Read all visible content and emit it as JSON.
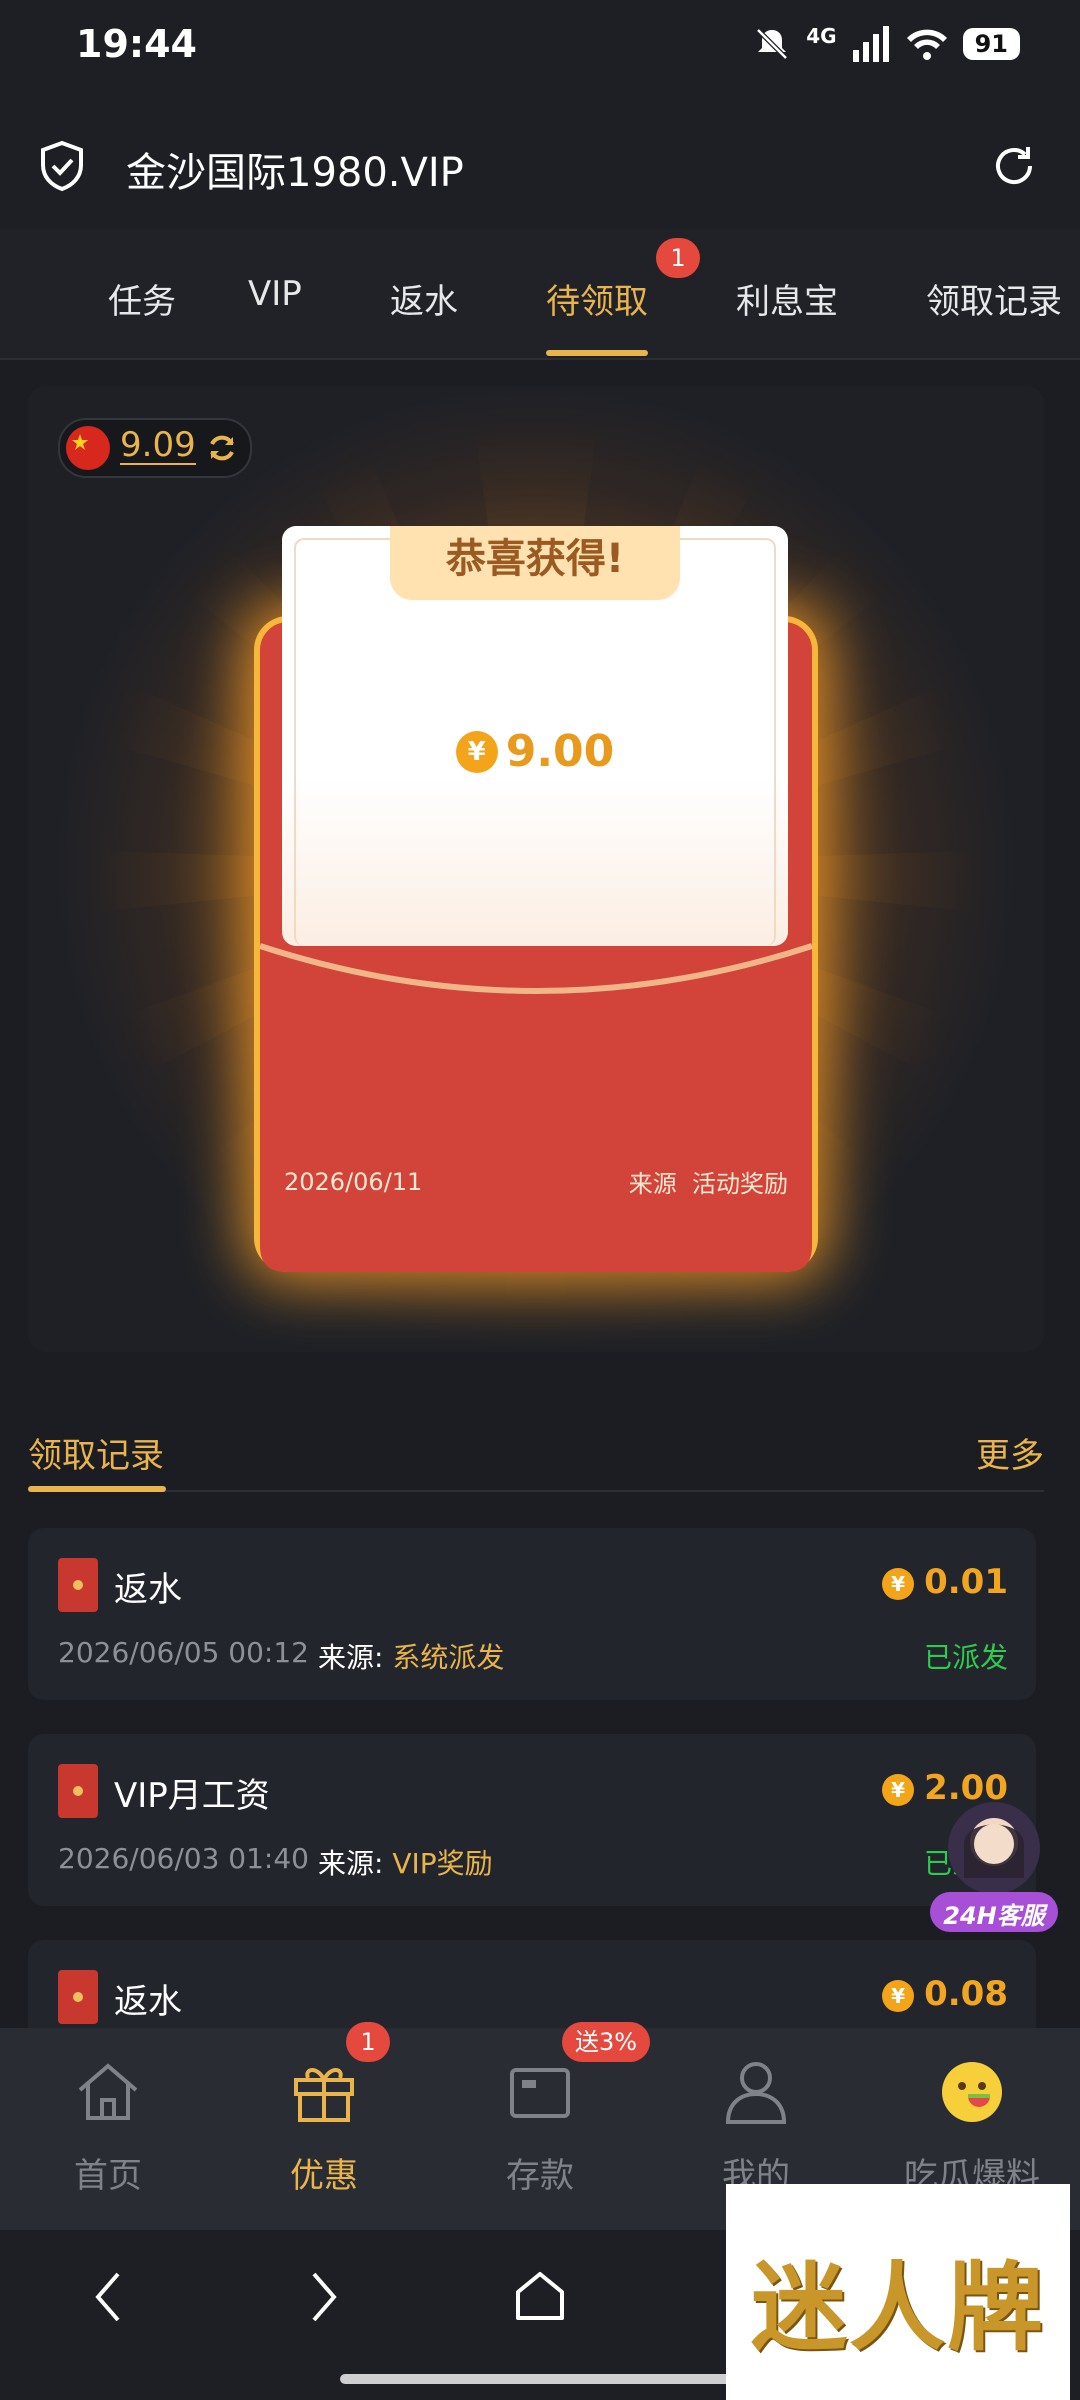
{
  "status_bar": {
    "time": "19:44",
    "network": "4G",
    "battery": "91"
  },
  "top_bar": {
    "title": "金沙国际1980.VIP"
  },
  "tabs": {
    "items": [
      {
        "label": "任务"
      },
      {
        "label": "VIP"
      },
      {
        "label": "返水"
      },
      {
        "label": "待领取",
        "active": true,
        "badge": "1"
      },
      {
        "label": "利息宝"
      },
      {
        "label": "领取记录"
      }
    ]
  },
  "hero": {
    "balance": "9.09",
    "card_title": "恭喜获得!",
    "currency_symbol": "¥",
    "amount": "9.00",
    "date": "2026/06/11",
    "source_label": "来源",
    "source_value": "活动奖励"
  },
  "records_header": {
    "title": "领取记录",
    "more": "更多"
  },
  "records": [
    {
      "title": "返水",
      "amount": "0.01",
      "time": "2026/06/05 00:12",
      "source_label": "来源:",
      "source": "系统派发",
      "status": "已派发"
    },
    {
      "title": "VIP月工资",
      "amount": "2.00",
      "time": "2026/06/03 01:40",
      "source_label": "来源:",
      "source": "VIP奖励",
      "status": "已派发"
    },
    {
      "title": "返水",
      "amount": "0.08"
    }
  ],
  "floating_service": {
    "label": "24H客服"
  },
  "bottom_nav": {
    "items": [
      {
        "label": "首页"
      },
      {
        "label": "优惠",
        "badge": "1",
        "active": true
      },
      {
        "label": "存款",
        "badge": "送3%"
      },
      {
        "label": "我的"
      },
      {
        "label": "吃瓜爆料"
      }
    ]
  },
  "watermark": {
    "text": "迷人牌"
  },
  "colors": {
    "accent": "#e9b44c",
    "background": "#1b1d23",
    "envelope_red": "#d2433a",
    "status_green": "#2ecc4e"
  }
}
